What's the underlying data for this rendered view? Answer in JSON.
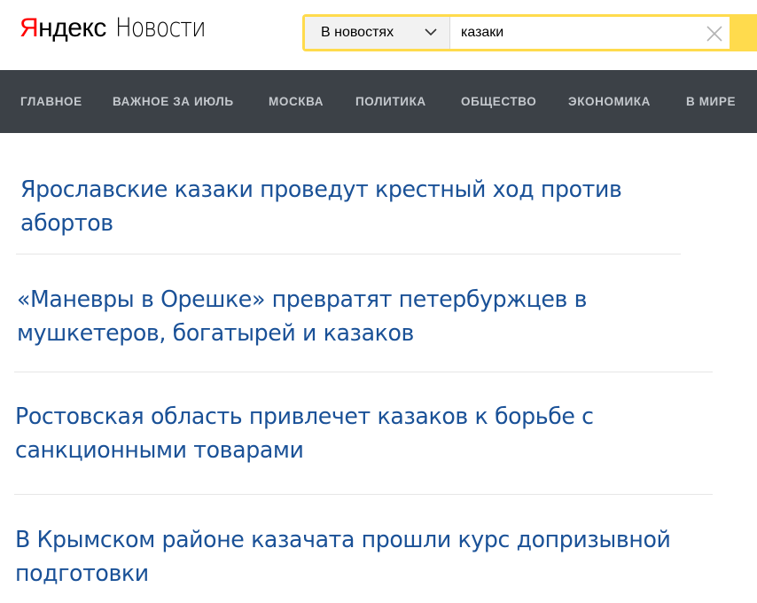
{
  "logo": {
    "yandex": "Яндекс",
    "yandex_first": "Я",
    "yandex_rest": "ндекс",
    "service": "Новости"
  },
  "search": {
    "scope_label": "В новостях",
    "query": "казаки"
  },
  "nav": {
    "items": [
      {
        "label": "ГЛАВНОЕ"
      },
      {
        "label": "ВАЖНОЕ ЗА ИЮЛЬ"
      },
      {
        "label": "МОСКВА"
      },
      {
        "label": "ПОЛИТИКА"
      },
      {
        "label": "ОБЩЕСТВО"
      },
      {
        "label": "ЭКОНОМИКА"
      },
      {
        "label": "В МИРЕ"
      }
    ]
  },
  "news": {
    "items": [
      {
        "title": "Ярославские казаки проведут крестный ход против абортов"
      },
      {
        "title": "«Маневры в Орешке» превратят петербуржцев в мушкетеров, богатырей и казаков"
      },
      {
        "title": "Ростовская область привлечет казаков к борьбе с санкционными товарами"
      },
      {
        "title": "В Крымском районе казачата прошли курс допризывной подготовки"
      }
    ]
  },
  "colors": {
    "accent": "#ffdb4d",
    "navbar": "#3c4147",
    "link": "#1a5197",
    "logo_red": "#ff0000"
  }
}
